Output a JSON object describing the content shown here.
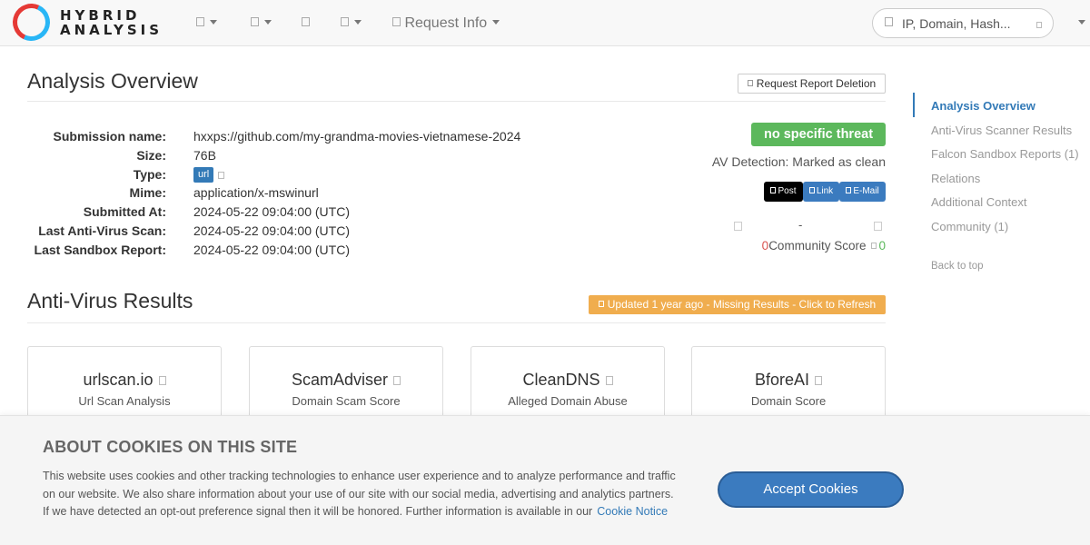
{
  "navbar": {
    "logo_line1": "HYBRID",
    "logo_line2": "ANALYSIS",
    "request_info_label": "Request Info",
    "search_placeholder": "IP, Domain, Hash..."
  },
  "overview": {
    "title": "Analysis Overview",
    "request_deletion_label": "Request Report Deletion",
    "labels": {
      "submission_name": "Submission name:",
      "size": "Size:",
      "type": "Type:",
      "mime": "Mime:",
      "submitted_at": "Submitted At:",
      "last_av_scan": "Last Anti-Virus Scan:",
      "last_sandbox": "Last Sandbox Report:"
    },
    "values": {
      "submission_name": "hxxps://github.com/my-grandma-movies-vietnamese-2024",
      "size": "76B",
      "type": "url",
      "mime": "application/x-mswinurl",
      "submitted_at": "2024-05-22 09:04:00 (UTC)",
      "last_av_scan": "2024-05-22 09:04:00 (UTC)",
      "last_sandbox": "2024-05-22 09:04:00 (UTC)"
    },
    "threat_verdict": "no specific threat",
    "av_detection": "AV Detection: Marked as clean",
    "share": {
      "post": "Post",
      "link": "Link",
      "email": "E-Mail"
    },
    "vote_dash": "-",
    "community_score_label": "Community Score",
    "community_score_negative": "0",
    "community_score_positive": "0"
  },
  "antivirus": {
    "title": "Anti-Virus Results",
    "refresh_label": "Updated 1 year ago - Missing Results - Click to Refresh",
    "cards": [
      {
        "title": "urlscan.io",
        "subtitle": "Url Scan Analysis"
      },
      {
        "title": "ScamAdviser",
        "subtitle": "Domain Scam Score"
      },
      {
        "title": "CleanDNS",
        "subtitle": "Alleged Domain Abuse"
      },
      {
        "title": "BforeAI",
        "subtitle": "Domain Score"
      }
    ]
  },
  "sidebar": {
    "items": [
      {
        "label": "Analysis Overview"
      },
      {
        "label": "Anti-Virus Scanner Results"
      },
      {
        "label": "Falcon Sandbox Reports (1)"
      },
      {
        "label": "Relations"
      },
      {
        "label": "Additional Context"
      },
      {
        "label": "Community (1)"
      }
    ],
    "back_to_top": "Back to top"
  },
  "cookie": {
    "title": "ABOUT COOKIES ON THIS SITE",
    "text": "This website uses cookies and other tracking technologies to enhance user experience and to analyze performance and traffic on our website. We also share information about your use of our site with our social media, advertising and analytics partners. If we have detected an opt-out preference signal then it will be honored. Further information is available in our",
    "link_label": "Cookie Notice",
    "accept_label": "Accept Cookies"
  },
  "colors": {
    "brand_blue": "#337ab7",
    "clean_green": "#5cb85c",
    "warning_orange": "#f0ad4e",
    "logo_red": "#e53935",
    "logo_cyan": "#29b6f6"
  }
}
